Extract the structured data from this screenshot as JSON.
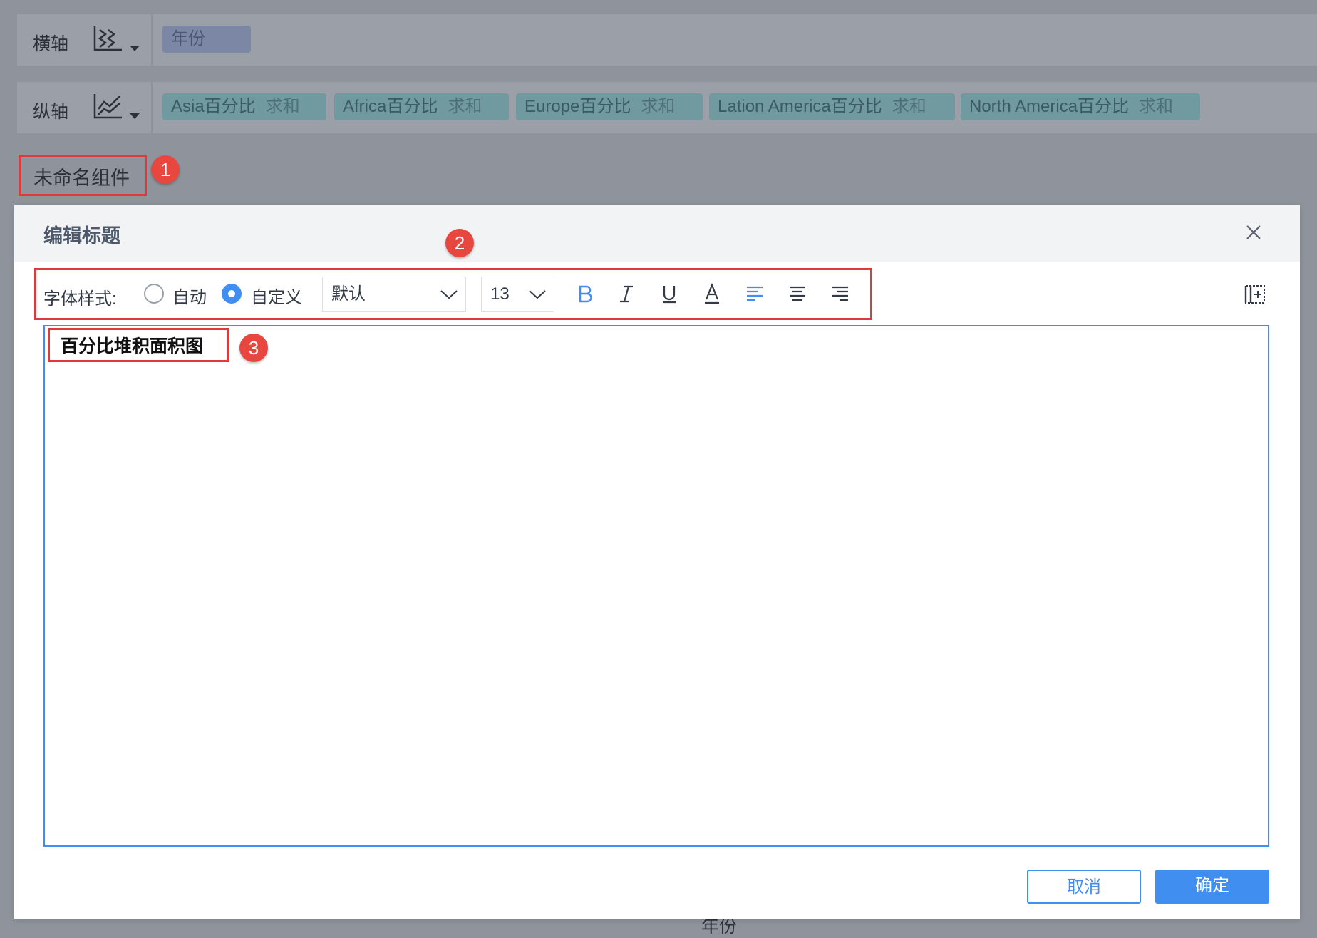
{
  "x_axis": {
    "label": "横轴",
    "fields": [
      "年份"
    ]
  },
  "y_axis": {
    "label": "纵轴",
    "fields": [
      {
        "name": "Asia百分比",
        "agg": "求和"
      },
      {
        "name": "Africa百分比",
        "agg": "求和"
      },
      {
        "name": "Europe百分比",
        "agg": "求和"
      },
      {
        "name": "Lation America百分比",
        "agg": "求和"
      },
      {
        "name": "North America百分比",
        "agg": "求和"
      }
    ]
  },
  "component": {
    "title": "未命名组件"
  },
  "callouts": [
    "1",
    "2",
    "3"
  ],
  "dialog": {
    "title": "编辑标题",
    "toolbar": {
      "font_style_label": "字体样式:",
      "options": [
        "自动",
        "自定义"
      ],
      "selected_option": "自定义",
      "font_family": "默认",
      "font_size": "13"
    },
    "editor_text": "百分比堆积面积图",
    "cancel_label": "取消",
    "confirm_label": "确定"
  },
  "footer_partial": "年份",
  "colors": {
    "accent": "#3f8ef0",
    "callout": "#e0393a",
    "overlay": "#8f949c"
  }
}
